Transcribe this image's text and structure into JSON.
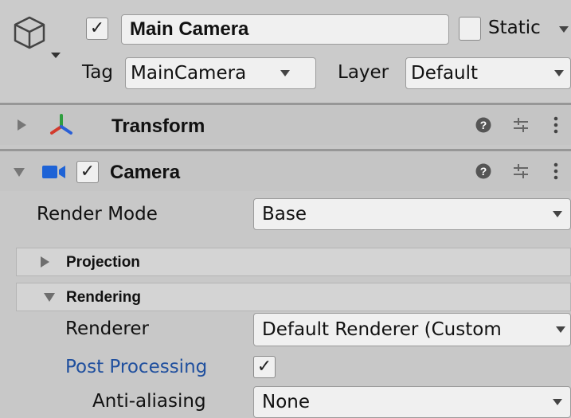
{
  "header": {
    "object_active": true,
    "name_value": "Main Camera",
    "static_label": "Static",
    "static_checked": false,
    "tag_label": "Tag",
    "tag_value": "MainCamera",
    "layer_label": "Layer",
    "layer_value": "Default"
  },
  "components": {
    "transform": {
      "title": "Transform",
      "icon": "transform-axes-icon",
      "expanded": false
    },
    "camera": {
      "title": "Camera",
      "icon": "camera-icon",
      "enabled": true,
      "expanded": true
    }
  },
  "camera": {
    "render_mode_label": "Render Mode",
    "render_mode_value": "Base",
    "projection_title": "Projection",
    "rendering_title": "Rendering",
    "renderer_label": "Renderer",
    "renderer_value": "Default Renderer (Custom",
    "post_processing_label": "Post Processing",
    "post_processing_checked": true,
    "anti_aliasing_label": "Anti-aliasing",
    "anti_aliasing_value": "None"
  },
  "colors": {
    "background": "#c8c8c8",
    "link_blue": "#1f4f9e",
    "camera_icon_blue": "#1e63d6",
    "axis_red": "#d33a2c",
    "axis_green": "#2f9e3f",
    "axis_blue": "#2a5fd6"
  }
}
